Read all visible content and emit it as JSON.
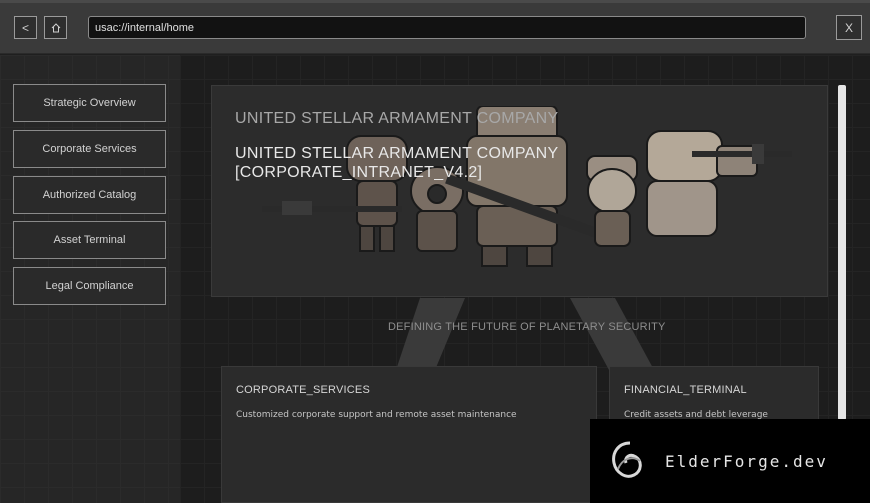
{
  "toolbar": {
    "back_label": "<",
    "home_icon": "home-icon",
    "address_value": "usac://internal/home",
    "close_label": "X"
  },
  "sidebar": {
    "items": [
      {
        "label": "Strategic Overview"
      },
      {
        "label": "Corporate Services"
      },
      {
        "label": "Authorized Catalog"
      },
      {
        "label": "Asset Terminal"
      },
      {
        "label": "Legal Compliance"
      }
    ]
  },
  "hero": {
    "title": "UNITED STELLAR ARMAMENT COMPANY",
    "subtitle_line1": "UNITED STELLAR ARMAMENT COMPANY",
    "subtitle_line2": "[CORPORATE_INTRANET_V4.2]"
  },
  "tagline": "DEFINING THE FUTURE OF PLANETARY SECURITY",
  "cards": [
    {
      "title": "CORPORATE_SERVICES",
      "desc": "Customized corporate support and remote asset maintenance"
    },
    {
      "title": "FINANCIAL_TERMINAL",
      "desc": "Credit assets and debt leverage"
    }
  ],
  "watermark": {
    "text": "ElderForge.dev"
  },
  "colors": {
    "background": "#1f1f1f",
    "panel": "#2c2c2c",
    "border": "#8a8a8a",
    "text": "#d2d2d2"
  }
}
